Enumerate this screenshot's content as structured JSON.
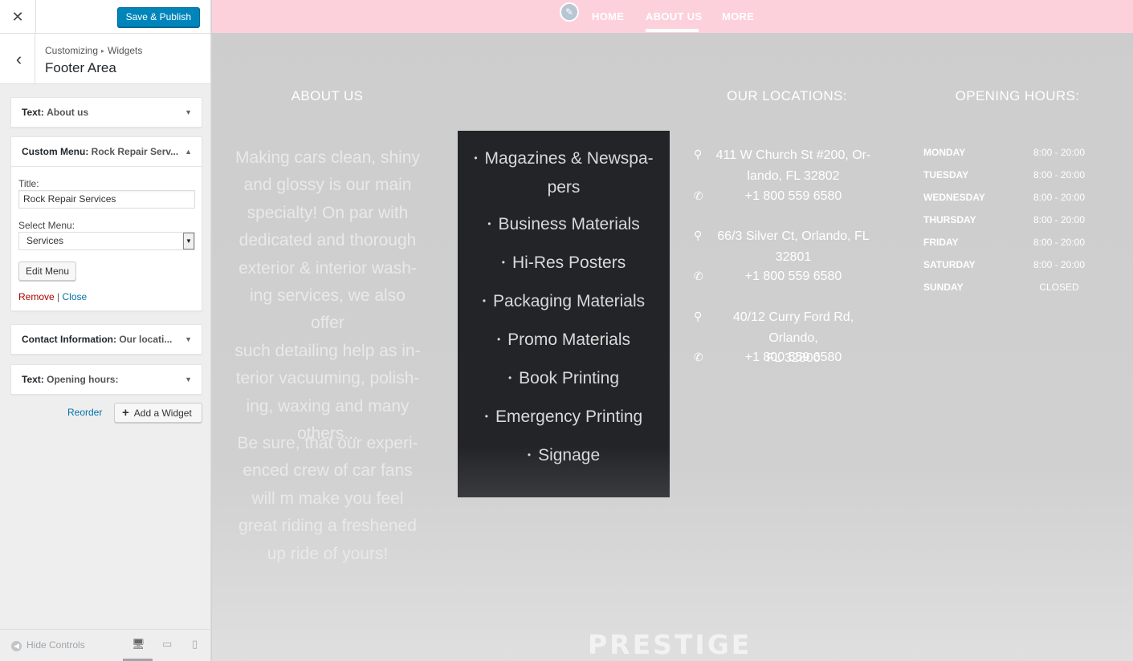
{
  "topbar": {
    "close_icon": "close-icon",
    "save_label": "Save & Publish",
    "accent": "#0085ba"
  },
  "section": {
    "breadcrumb_root": "Customizing",
    "breadcrumb_child": "Widgets",
    "title": "Footer Area",
    "back_icon": "chevron-left-icon"
  },
  "widgets": [
    {
      "type": "Text:",
      "name": "About us"
    },
    {
      "type": "Custom Menu:",
      "name": "Rock Repair Serv..."
    },
    {
      "type": "Contact Information:",
      "name": "Our locati..."
    },
    {
      "type": "Text:",
      "name": "Opening hours:"
    }
  ],
  "menu_form": {
    "title_label": "Title:",
    "title_value": "Rock Repair Services",
    "select_label": "Select Menu:",
    "select_value": "Services",
    "edit_button": "Edit Menu",
    "remove_link": "Remove",
    "separator": "|",
    "close_link": "Close"
  },
  "actions": {
    "reorder": "Reorder",
    "add_widget": "Add a Widget"
  },
  "footer": {
    "hide_controls": "Hide Controls",
    "devices": [
      "desktop-icon",
      "tablet-icon",
      "mobile-icon"
    ]
  },
  "preview": {
    "nav": {
      "home": "HOME",
      "about": "ABOUT US",
      "more": "MORE",
      "bar_color": "#fdd1dc"
    },
    "about": {
      "title": "ABOUT US",
      "p1_lines": [
        "Making cars clean, shiny",
        "and glossy is our main",
        "specialty! On par with",
        "dedicated and thorough",
        "exterior & interior wash-",
        "ing services, we also offer",
        "such detailing help as in-",
        "terior vacuuming, polish-",
        "ing, waxing and many",
        "others..."
      ],
      "p2_lines": [
        "Be sure, that our experi-",
        "enced crew of car fans",
        "will m make you feel",
        "great riding a freshened",
        "up ride of yours!"
      ]
    },
    "menu_lines": [
      [
        "Magazines & Newspa-",
        "pers"
      ],
      [
        "Business Materials"
      ],
      [
        "Hi-Res Posters"
      ],
      [
        "Packaging Materials"
      ],
      [
        "Promo Materials"
      ],
      [
        "Book Printing"
      ],
      [
        "Emergency Printing"
      ],
      [
        "Signage"
      ]
    ],
    "locations": {
      "title": "OUR LOCATIONS:",
      "items": [
        {
          "address_lines": [
            "411 W Church St #200, Or-",
            "lando, FL 32802"
          ],
          "phone": "+1 800 559 6580"
        },
        {
          "address_lines": [
            "66/3 Silver Ct, Orlando, FL",
            "32801"
          ],
          "phone": "+1 800 559 6580"
        },
        {
          "address_lines": [
            "40/12 Curry Ford Rd, Orlando,",
            "FL 32800"
          ],
          "phone": "+1 800 559 6580"
        }
      ]
    },
    "hours": {
      "title": "OPENING HOURS:",
      "rows": [
        {
          "day": "MONDAY",
          "time": "8:00 - 20:00"
        },
        {
          "day": "TUESDAY",
          "time": "8:00 - 20:00"
        },
        {
          "day": "WEDNESDAY",
          "time": "8:00 - 20:00"
        },
        {
          "day": "THURSDAY",
          "time": "8:00 - 20:00"
        },
        {
          "day": "FRIDAY",
          "time": "8:00 - 20:00"
        },
        {
          "day": "SATURDAY",
          "time": "8:00 - 20:00"
        },
        {
          "day": "SUNDAY",
          "time": "CLOSED"
        }
      ]
    },
    "brand": "PRESTIGE"
  }
}
